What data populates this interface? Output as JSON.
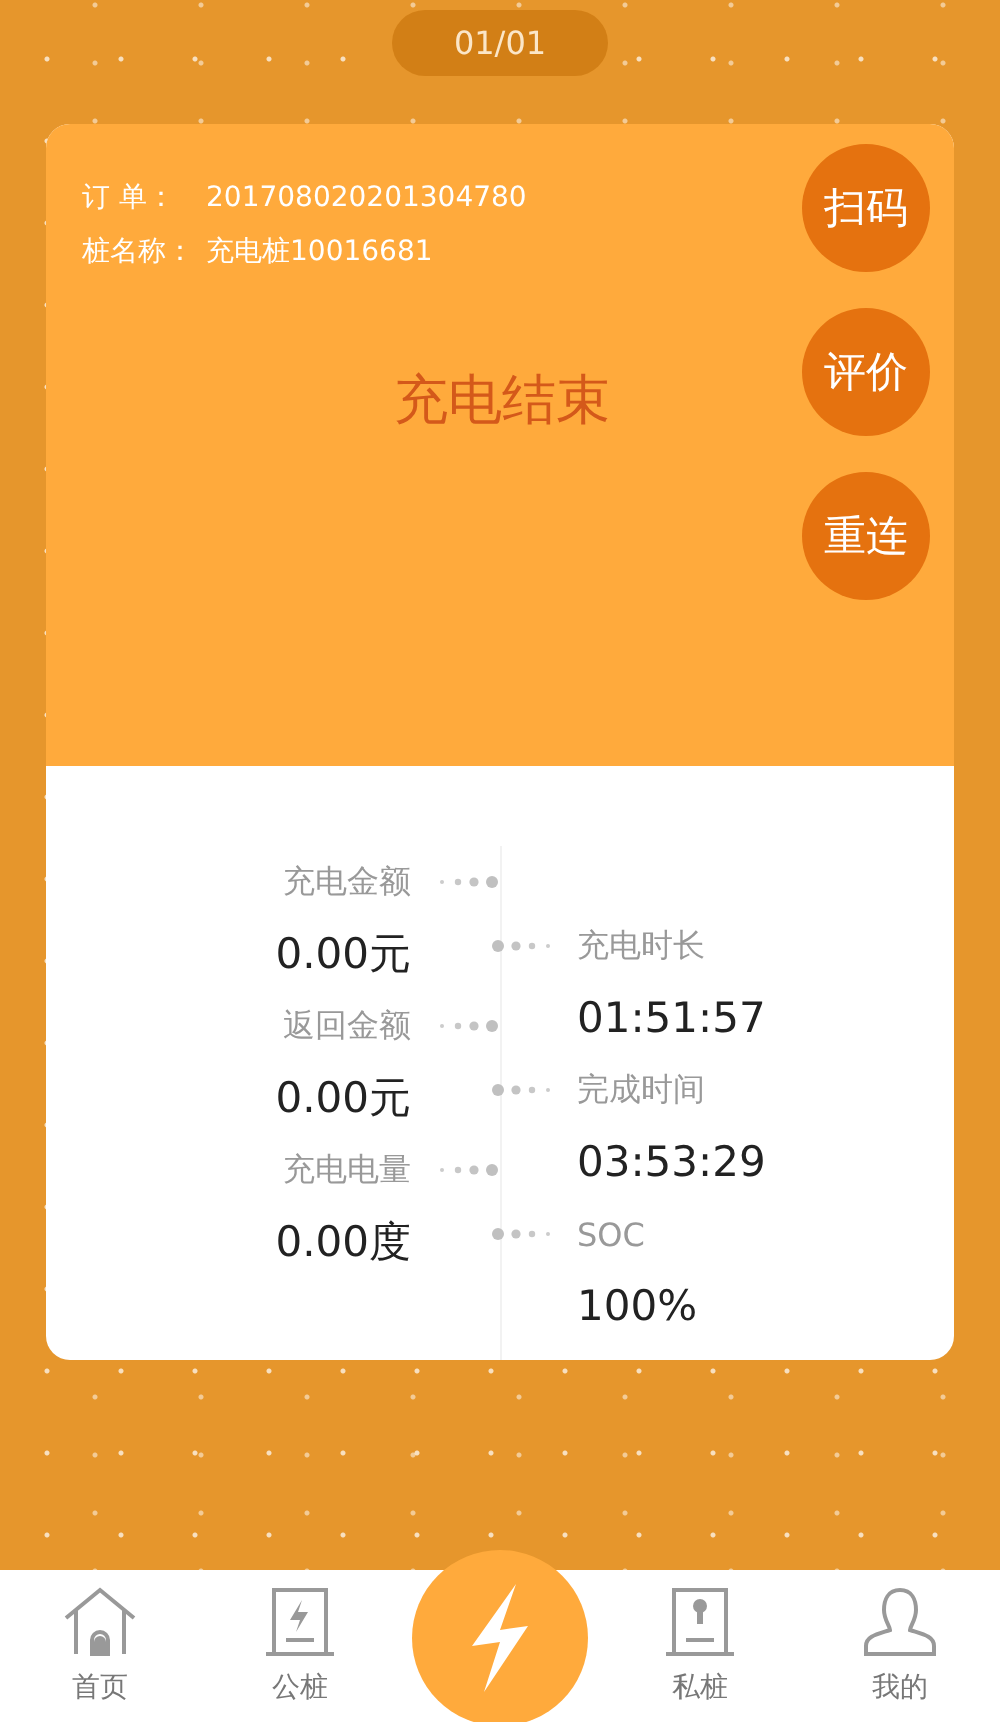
{
  "pager": "01/01",
  "order": {
    "label": "订 单：",
    "value": "201708020201304780"
  },
  "station": {
    "label": "桩名称：",
    "value": "充电桩10016681"
  },
  "status": "充电结束",
  "actions": [
    "扫码",
    "评价",
    "重连"
  ],
  "left_stats": [
    {
      "label": "充电金额",
      "value": "0.00元"
    },
    {
      "label": "返回金额",
      "value": "0.00元"
    },
    {
      "label": "充电电量",
      "value": "0.00度"
    }
  ],
  "right_stats": [
    {
      "label": "充电时长",
      "value": "01:51:57"
    },
    {
      "label": "完成时间",
      "value": "03:53:29"
    },
    {
      "label": "SOC",
      "value": "100%"
    }
  ],
  "nav": [
    {
      "label": "首页",
      "kind": "home"
    },
    {
      "label": "公桩",
      "kind": "public"
    },
    {
      "kind": "charge"
    },
    {
      "label": "私桩",
      "kind": "private"
    },
    {
      "label": "我的",
      "kind": "user"
    }
  ]
}
